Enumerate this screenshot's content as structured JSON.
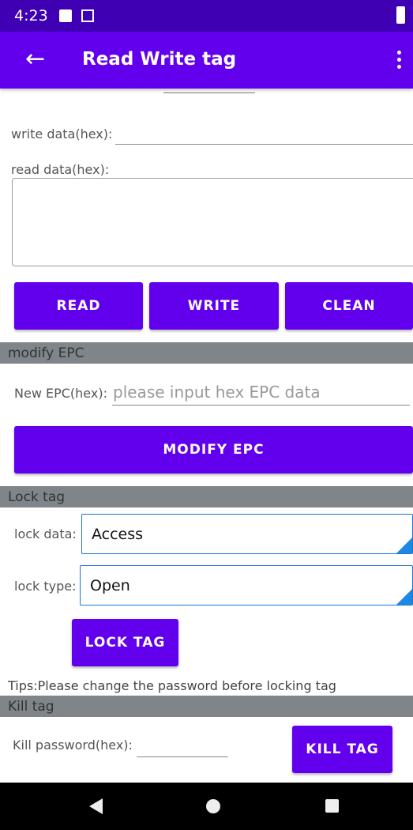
{
  "status_bar": {
    "time": "4:23"
  },
  "app_bar": {
    "title": "Read Write tag"
  },
  "read_write": {
    "write_label": "write data(hex):",
    "read_label": "read data(hex):",
    "read_button": "READ",
    "write_button": "WRITE",
    "clean_button": "CLEAN"
  },
  "modify_epc": {
    "header": "modify EPC",
    "new_epc_label": "New EPC(hex):",
    "new_epc_placeholder": "please input hex EPC data",
    "modify_button": "MODIFY EPC"
  },
  "lock_tag": {
    "header": "Lock tag",
    "lock_data_label": "lock data:",
    "lock_data_value": "Access",
    "lock_type_label": "lock type:",
    "lock_type_value": "Open",
    "lock_button": "LOCK TAG",
    "tips": "Tips:Please change the password before locking tag"
  },
  "kill_tag": {
    "header": "Kill tag",
    "kill_password_label": "Kill password(hex):",
    "kill_button": "KILL TAG"
  },
  "colors": {
    "primary": "#6200ee",
    "status_bar": "#3f00b3",
    "section_header": "#7f8588",
    "spinner_accent": "#1e88e5"
  }
}
